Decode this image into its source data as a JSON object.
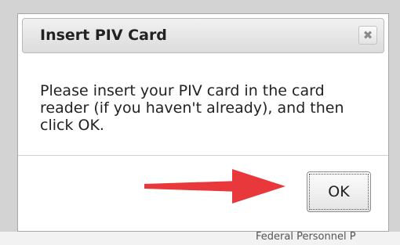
{
  "background": {
    "partial_text": "Federal Personnel P"
  },
  "dialog": {
    "title": "Insert PIV Card",
    "close_icon": "close-icon",
    "close_glyph": "✖",
    "message": "Please insert your PIV card in the card reader (if you haven't already), and then click OK.",
    "ok_label": "OK"
  },
  "annotation": {
    "arrow_icon": "right-arrow-icon",
    "arrow_color": "#e8383b"
  }
}
